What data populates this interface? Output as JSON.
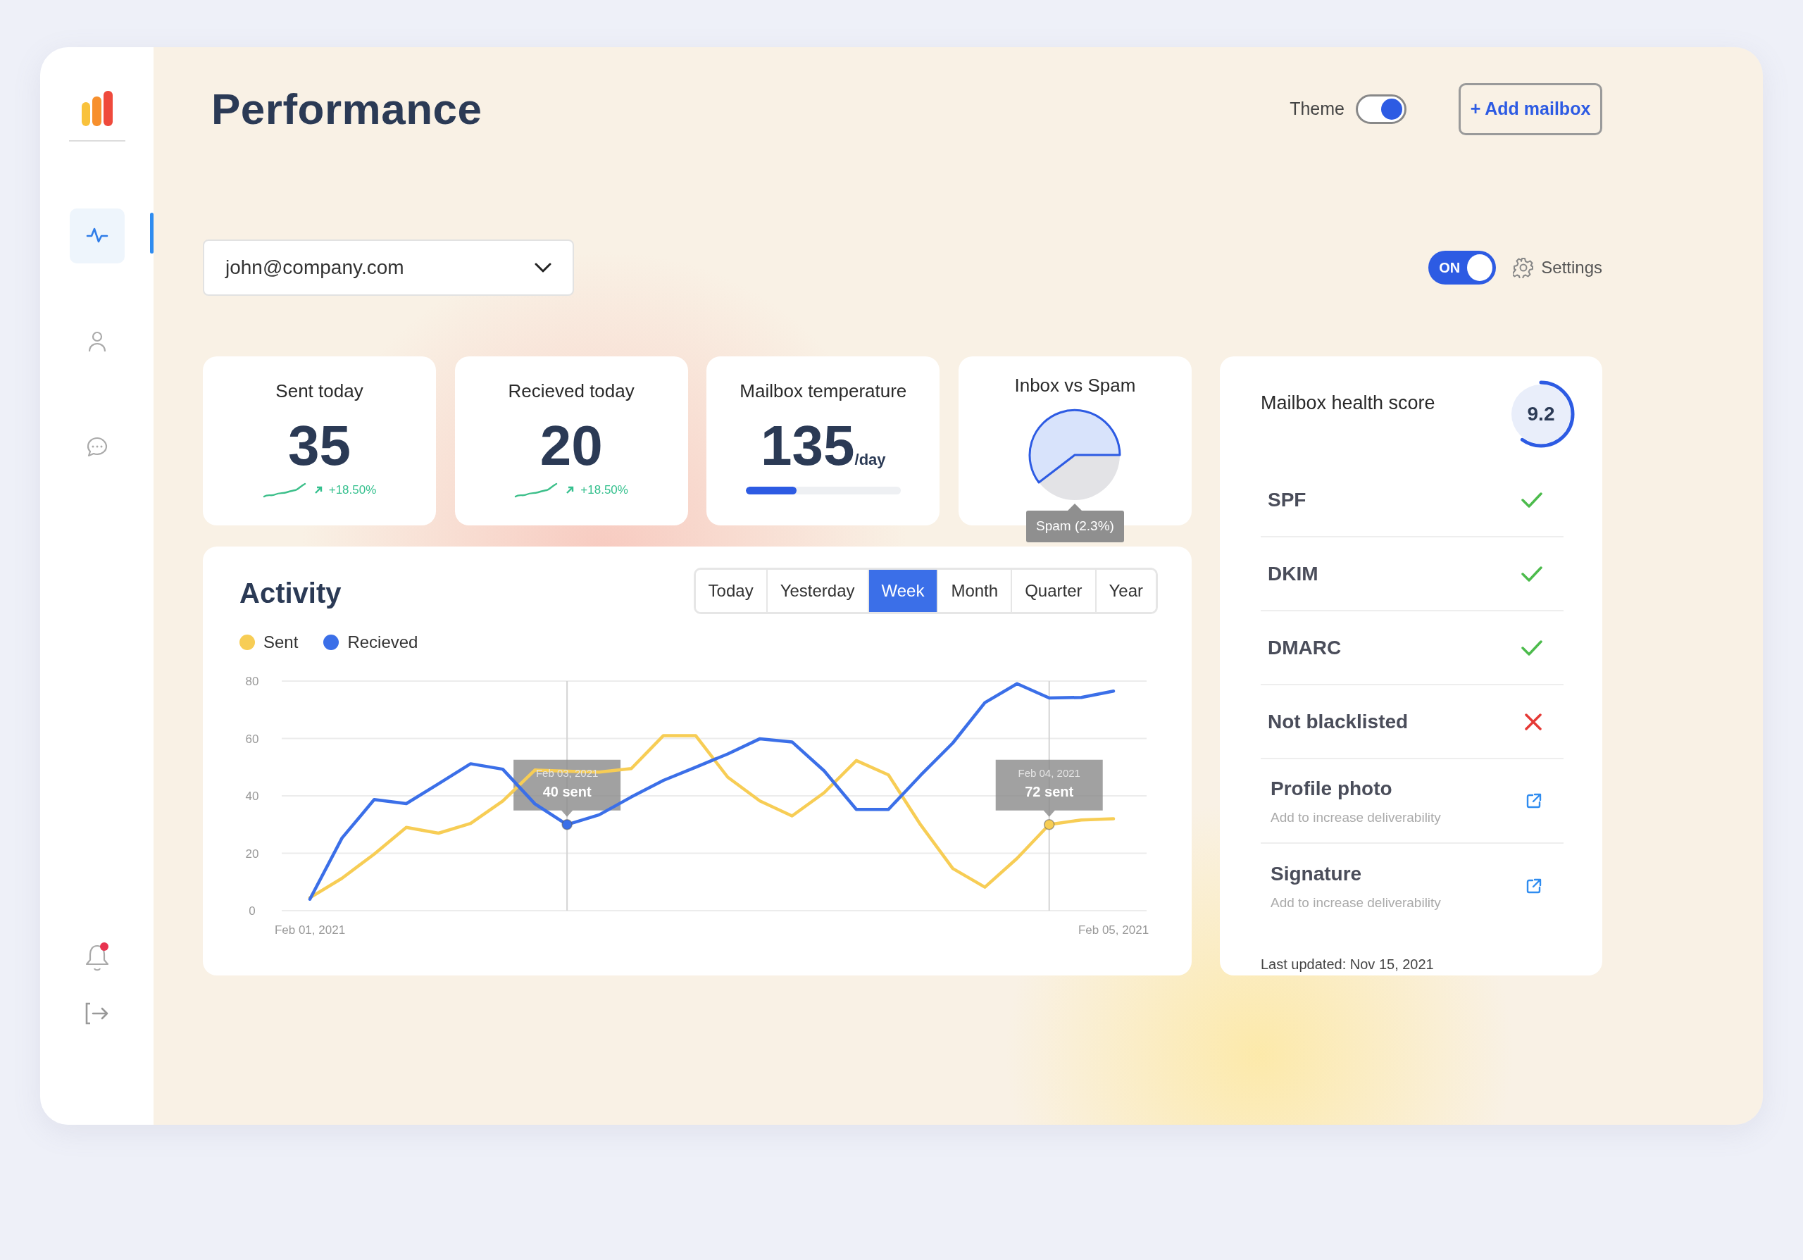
{
  "sidebar": {
    "items": [
      {
        "selected": true
      },
      {
        "selected": false
      },
      {
        "selected": false
      }
    ],
    "notifications": true
  },
  "header": {
    "title": "Performance",
    "theme_toggle": {
      "label": "Theme",
      "on": true
    },
    "add_button": "+ Add mailbox"
  },
  "toolbar": {
    "mailbox": "john@company.com",
    "status_toggle": {
      "label": "ON",
      "on": true
    },
    "settings": "Settings"
  },
  "stats": [
    {
      "kind": "count",
      "title": "Sent today",
      "value": "35",
      "change": "+18.50%"
    },
    {
      "kind": "count",
      "title": "Recieved today",
      "value": "20",
      "change": "+18.50%"
    },
    {
      "kind": "rate",
      "title": "Mailbox temperature",
      "value": "135",
      "unit": "/day",
      "level": 0.33
    },
    {
      "kind": "pie",
      "title": "Inbox vs Spam",
      "tooltip": "Spam (2.3%)"
    }
  ],
  "activity": {
    "title": "Activity",
    "tabs": [
      {
        "label": "Today",
        "selected": false
      },
      {
        "label": "Yesterday",
        "selected": false
      },
      {
        "label": "Week",
        "selected": true
      },
      {
        "label": "Month",
        "selected": false
      },
      {
        "label": "Quarter",
        "selected": false
      },
      {
        "label": "Year",
        "selected": false
      }
    ],
    "chart_data": {
      "type": "line",
      "grid": true,
      "categories": [
        "Feb 01, 2021",
        null,
        null,
        null,
        null,
        null,
        null,
        null,
        null,
        null,
        null,
        null,
        null,
        null,
        null,
        null,
        null,
        null,
        null,
        null,
        null,
        null,
        null,
        null,
        null,
        "Feb 05, 2021"
      ],
      "series": [
        {
          "name": "Sent",
          "color": "#f7cd55",
          "values": [
            4.5,
            11.3,
            19.7,
            29,
            27,
            30.4,
            38.2,
            49,
            48.6,
            48.3,
            49.5,
            61,
            61,
            46.5,
            38.2,
            33,
            41.1,
            52.3,
            47.3,
            29.9,
            14.7,
            8.2,
            18.2,
            30,
            31.6,
            32
          ]
        },
        {
          "name": "Recieved",
          "color": "#3b6fe8",
          "values": [
            4,
            25.3,
            38.7,
            37.3,
            44.2,
            51.2,
            49.3,
            37.2,
            30,
            33.4,
            39.6,
            45.4,
            50,
            54.6,
            59.9,
            58.8,
            48.7,
            35.3,
            35.3,
            47.2,
            58.4,
            72.5,
            79.1,
            74.1,
            74.3,
            76.5
          ]
        }
      ],
      "ylim": [
        0,
        80
      ],
      "yticks": [
        0,
        20,
        40,
        60,
        80
      ],
      "annotations": [
        {
          "y": 30,
          "text": "Feb 03, 2021\n40 sent"
        },
        {
          "y": 30,
          "text": "Feb 04, 2021\n72 sent"
        }
      ]
    }
  },
  "health": {
    "title": "Mailbox health score",
    "score": "9.2",
    "level": 0.6,
    "items": [
      {
        "kind": "check",
        "label": "SPF",
        "ok": true
      },
      {
        "kind": "check",
        "label": "DKIM",
        "ok": true
      },
      {
        "kind": "check",
        "label": "DMARC",
        "ok": true
      },
      {
        "kind": "check",
        "label": "Not blacklisted",
        "ok": false
      },
      {
        "kind": "action",
        "label": "Profile photo",
        "subtitle": "Add to increase deliverability"
      },
      {
        "kind": "action",
        "label": "Signature",
        "subtitle": "Add to increase deliverability"
      }
    ],
    "last_updated": "Last updated: Nov 15, 2021"
  }
}
